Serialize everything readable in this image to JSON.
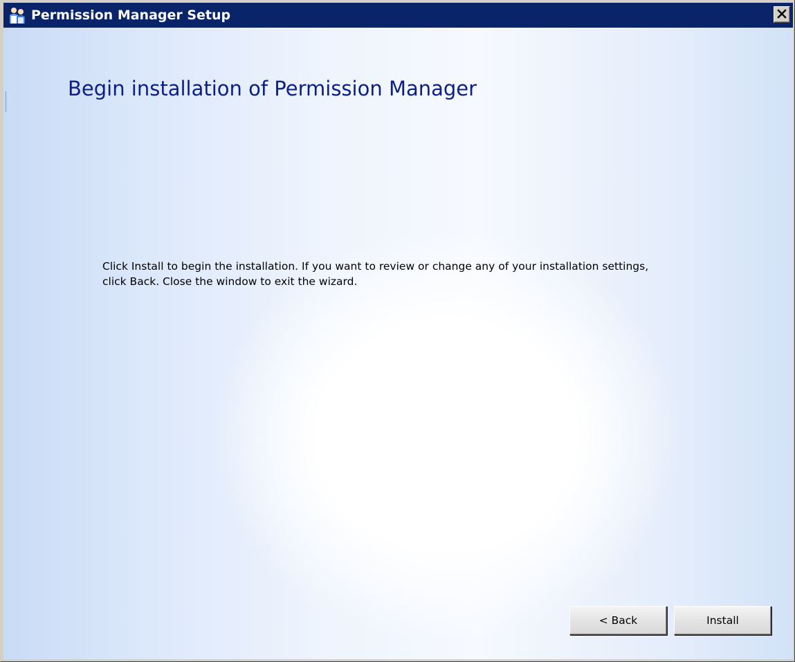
{
  "window": {
    "title": "Permission Manager Setup"
  },
  "page": {
    "heading": "Begin installation of Permission Manager",
    "line1": "Click Install to begin the installation.  If you want to review or change any of your installation settings,",
    "line2": "click Back.  Close the window to exit the wizard."
  },
  "buttons": {
    "back_label": "< Back",
    "install_label": "Install"
  },
  "colors": {
    "titlebar": "#0a246a",
    "heading": "#0b1f86",
    "background_tint": "#dce8fb"
  },
  "icons": {
    "app": "people-icon",
    "close": "close-icon"
  }
}
